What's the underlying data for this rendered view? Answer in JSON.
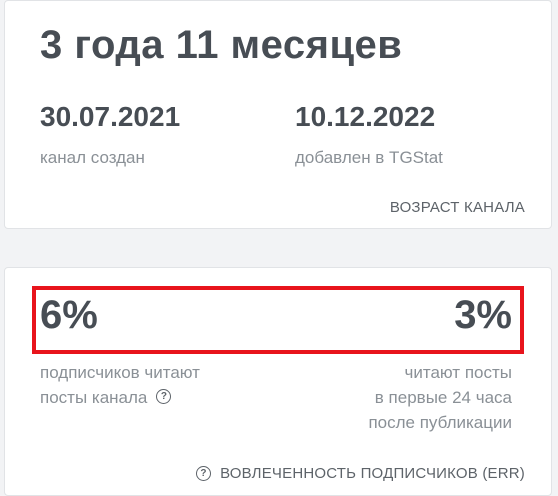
{
  "age_card": {
    "title": "3 года 11 месяцев",
    "created": {
      "date": "30.07.2021",
      "label": "канал создан"
    },
    "added": {
      "date": "10.12.2022",
      "label": "добавлен в TGStat"
    },
    "footer": "ВОЗРАСТ КАНАЛА"
  },
  "err_card": {
    "left": {
      "value": "6%",
      "label_line1": "подписчиков читают",
      "label_line2": "посты канала",
      "help_icon": "question-circle-icon"
    },
    "right": {
      "value": "3%",
      "label_line1": "читают посты",
      "label_line2": "в первые 24 часа",
      "label_line3": "после публикации"
    },
    "footer": "ВОВЛЕЧЕННОСТЬ ПОДПИСЧИКОВ (ERR)",
    "footer_icon": "question-circle-icon",
    "highlight_color": "#e8141c"
  },
  "help_glyph": "?"
}
